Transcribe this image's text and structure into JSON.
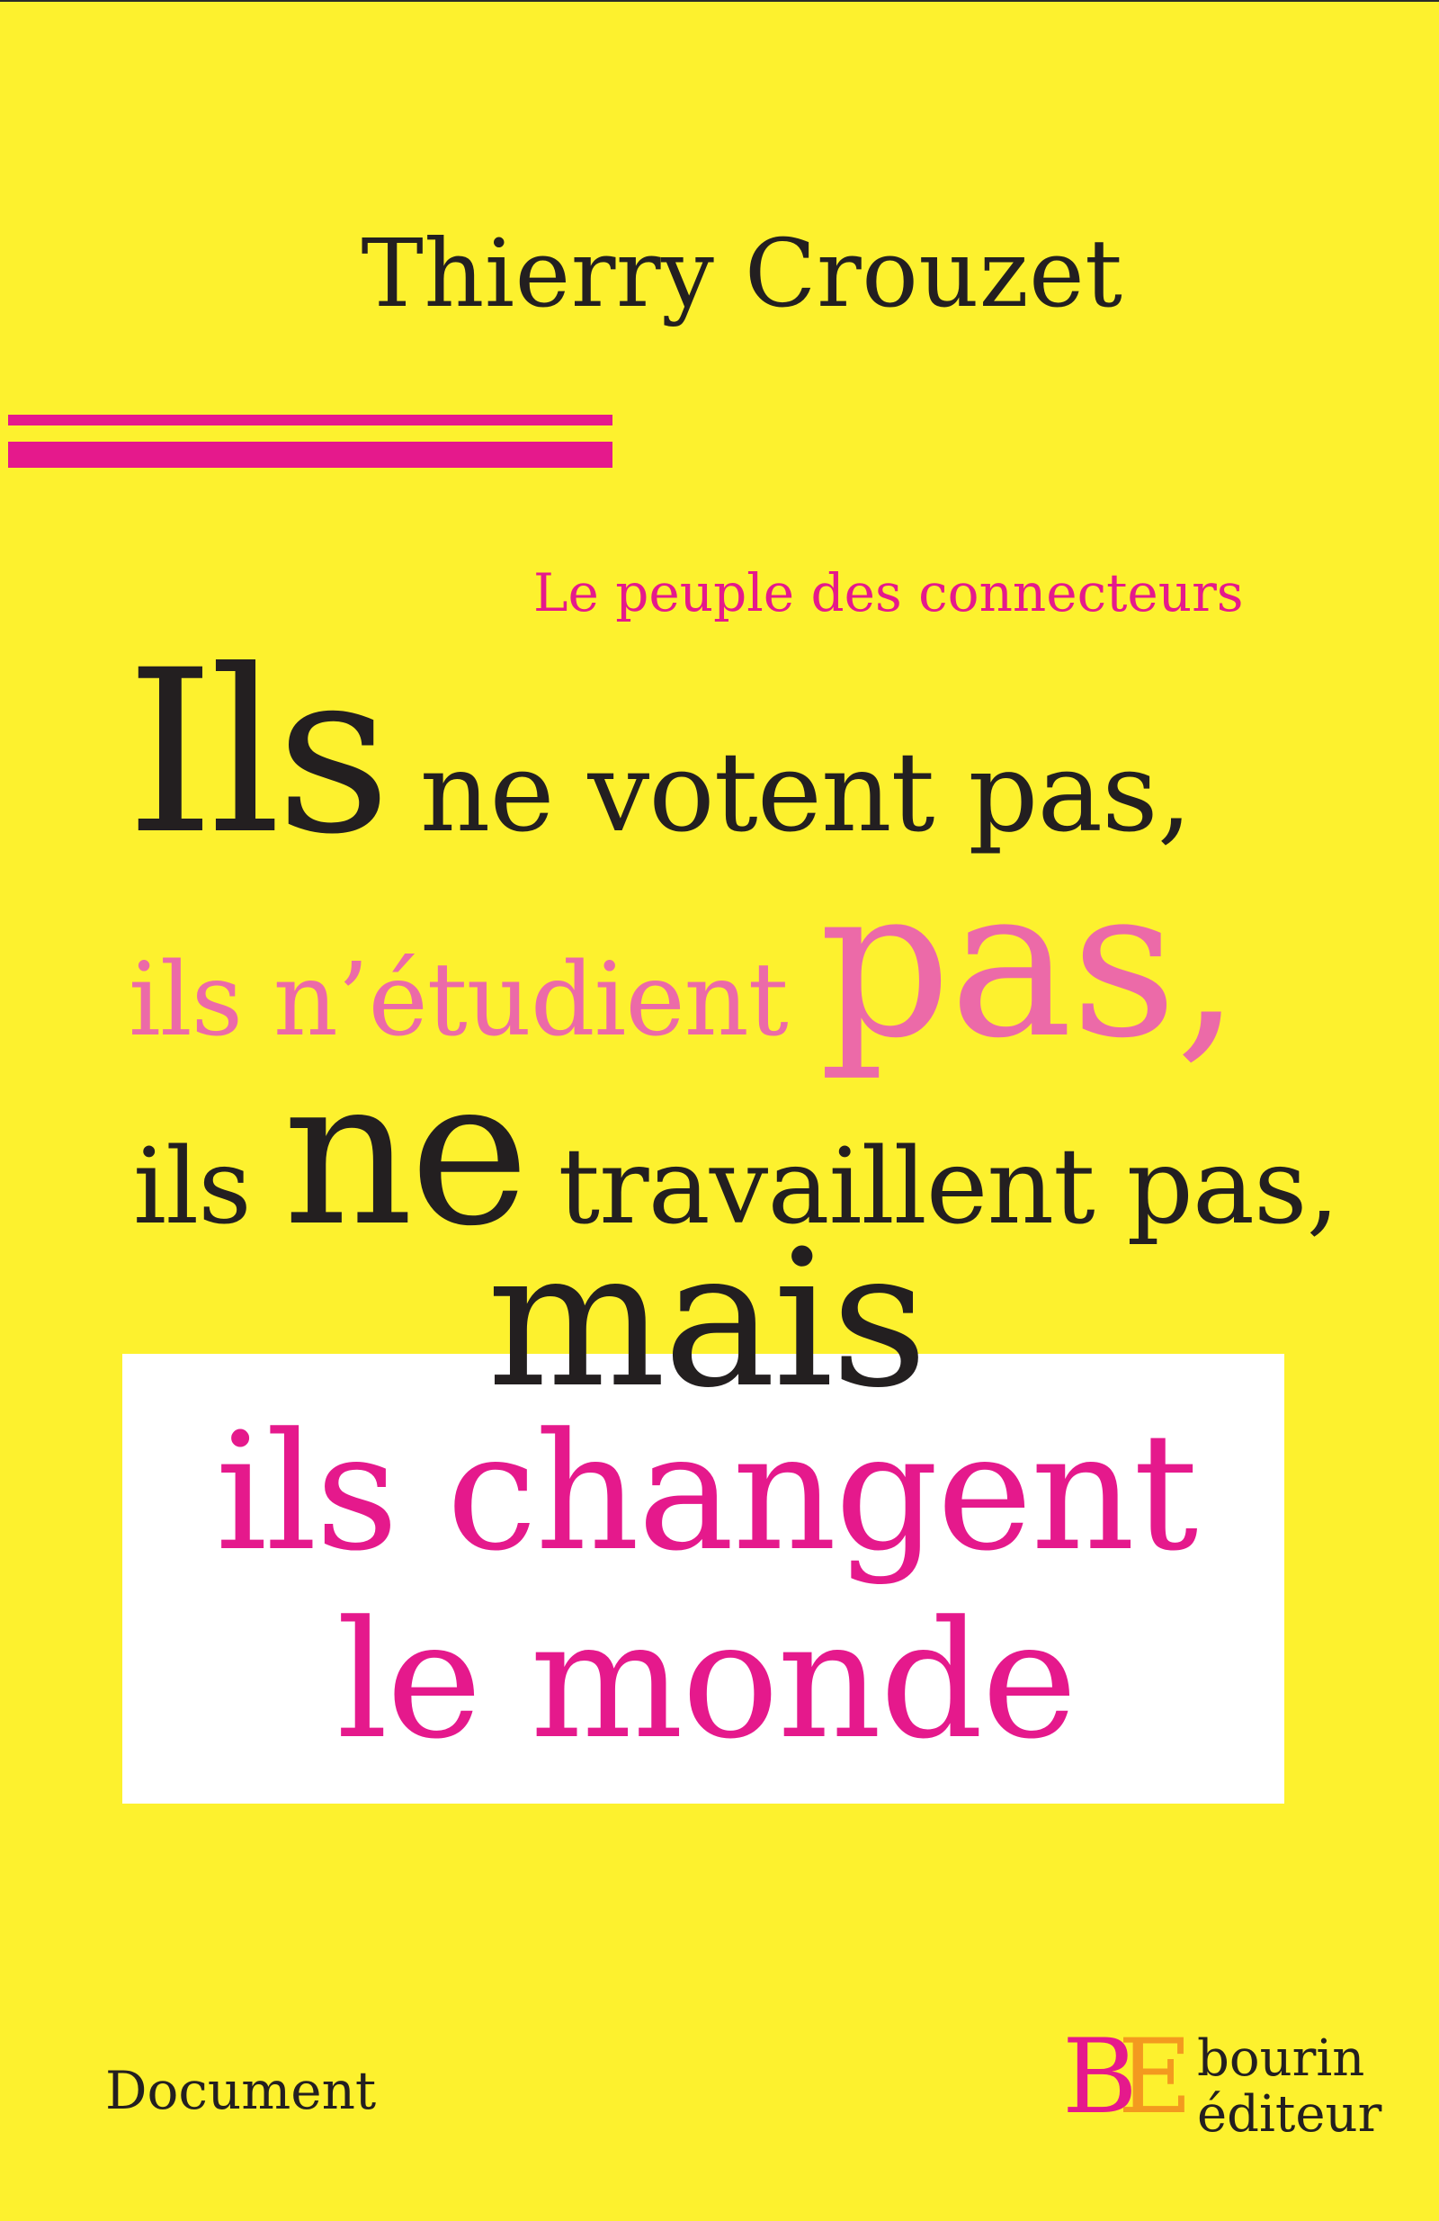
{
  "colors": {
    "background": "#fdf12e",
    "ink": "#231f20",
    "magenta": "#e5198c",
    "pink": "#ec6aa8",
    "orange": "#f39a1f",
    "box": "#ffffff"
  },
  "cover": {
    "author": "Thierry Crouzet",
    "series": "Le peuple des connecteurs",
    "title": {
      "line1": {
        "big": "Ils",
        "rest": " ne votent pas,"
      },
      "line2": {
        "lead": "ils n’étudient ",
        "big": "pas",
        "tail": ","
      },
      "line3": {
        "lead": "ils ",
        "big": "ne",
        "rest": " travaillent pas,"
      },
      "line4": "mais",
      "line5": "ils changent",
      "line6": "le monde"
    },
    "genre": "Document",
    "publisher": {
      "mark_b": "B",
      "mark_e": "E",
      "line1": "bourin",
      "line2": "éditeur"
    }
  }
}
